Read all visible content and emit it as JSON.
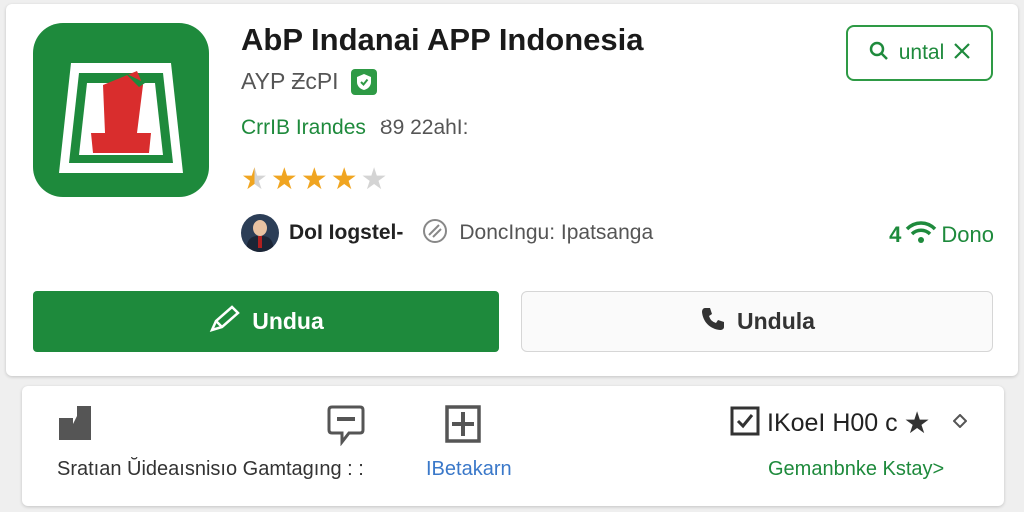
{
  "app": {
    "title": "AbP Indanai APP Indonesia",
    "developer": "AYP ƵcPI",
    "category": "CrrIB Irandes",
    "age_rating": "Ȣ9 22ahI:",
    "rating_stars": 3.5,
    "icon_name": "app-logo-icon"
  },
  "info": {
    "author": "DoI Iogstel-",
    "language": "DoncIngu: Ipatsanga",
    "connection_count": "4",
    "connection_label": "Dono"
  },
  "search": {
    "label": "untal"
  },
  "buttons": {
    "primary_label": "Undua",
    "secondary_label": "Undula"
  },
  "bottom": {
    "left_text": "Sratıan Ŭideaısnisıo Gamtagıng : :",
    "link_text": "IBetakarn",
    "right_heading": "IKoeI H00 c",
    "right_link": "Gemanbnke Kstay>"
  },
  "colors": {
    "brand_green": "#1e8a3c",
    "star": "#f0a521",
    "brand_red": "#d92d2d"
  }
}
